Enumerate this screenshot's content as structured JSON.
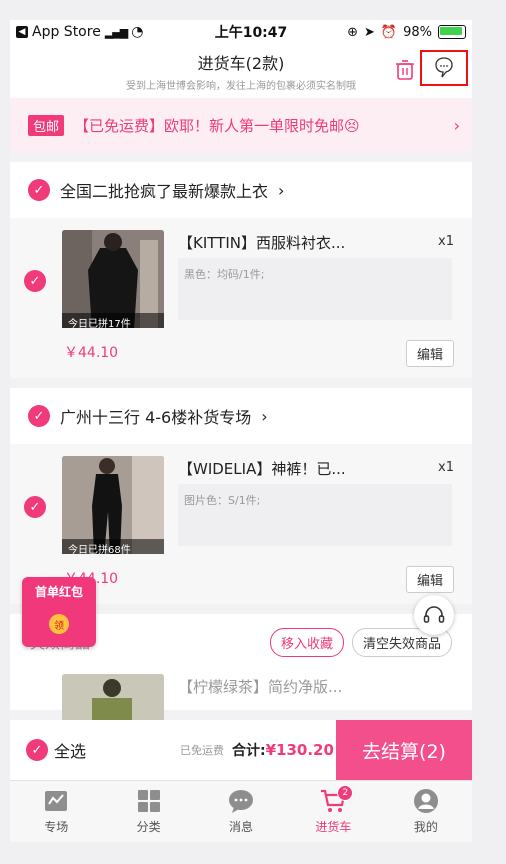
{
  "status_bar": {
    "carrier": "App Store",
    "time": "上午10:47",
    "battery": "98%"
  },
  "header": {
    "title": "进货车(2款)",
    "subtitle": "受到上海世博会影响，发往上海的包裹必须实名制哦"
  },
  "promo": {
    "tag": "包邮",
    "text": "【已免运费】欧耶！新人第一单限时免邮😣"
  },
  "shops": [
    {
      "name": "全国二批抢疯了最新爆款上衣",
      "item": {
        "title": "【KITTIN】西服料衬衣...",
        "qty": "x1",
        "spec": "黑色：均码/1件;",
        "thumb_caption": "今日已拼17件",
        "price": "￥44.10",
        "edit": "编辑"
      }
    },
    {
      "name": "广州十三行 4-6楼补货专场",
      "item": {
        "title": "【WIDELIA】神裤！已...",
        "qty": "x1",
        "spec": "图片色：S/1件;",
        "thumb_caption": "今日已拼68件",
        "price": "￥44.10",
        "edit": "编辑"
      }
    }
  ],
  "invalid": {
    "title": "失效商品",
    "move_to_fav": "移入收藏",
    "clear": "清空失效商品",
    "item_title": "【柠檬绿茶】简约净版..."
  },
  "redpacket": {
    "title": "首单红包",
    "coin": "领"
  },
  "bottom": {
    "select_all": "全选",
    "free_shipping": "已免运费",
    "total_label": "合计:",
    "total_value": "¥130.20",
    "checkout": "去结算(2)"
  },
  "tabs": [
    {
      "label": "专场",
      "icon": "venue-icon"
    },
    {
      "label": "分类",
      "icon": "grid-icon"
    },
    {
      "label": "消息",
      "icon": "message-icon"
    },
    {
      "label": "进货车",
      "icon": "cart-icon",
      "badge": "2",
      "active": true
    },
    {
      "label": "我的",
      "icon": "profile-icon"
    }
  ],
  "colors": {
    "accent": "#f03a79",
    "checkout": "#f24f8c"
  }
}
